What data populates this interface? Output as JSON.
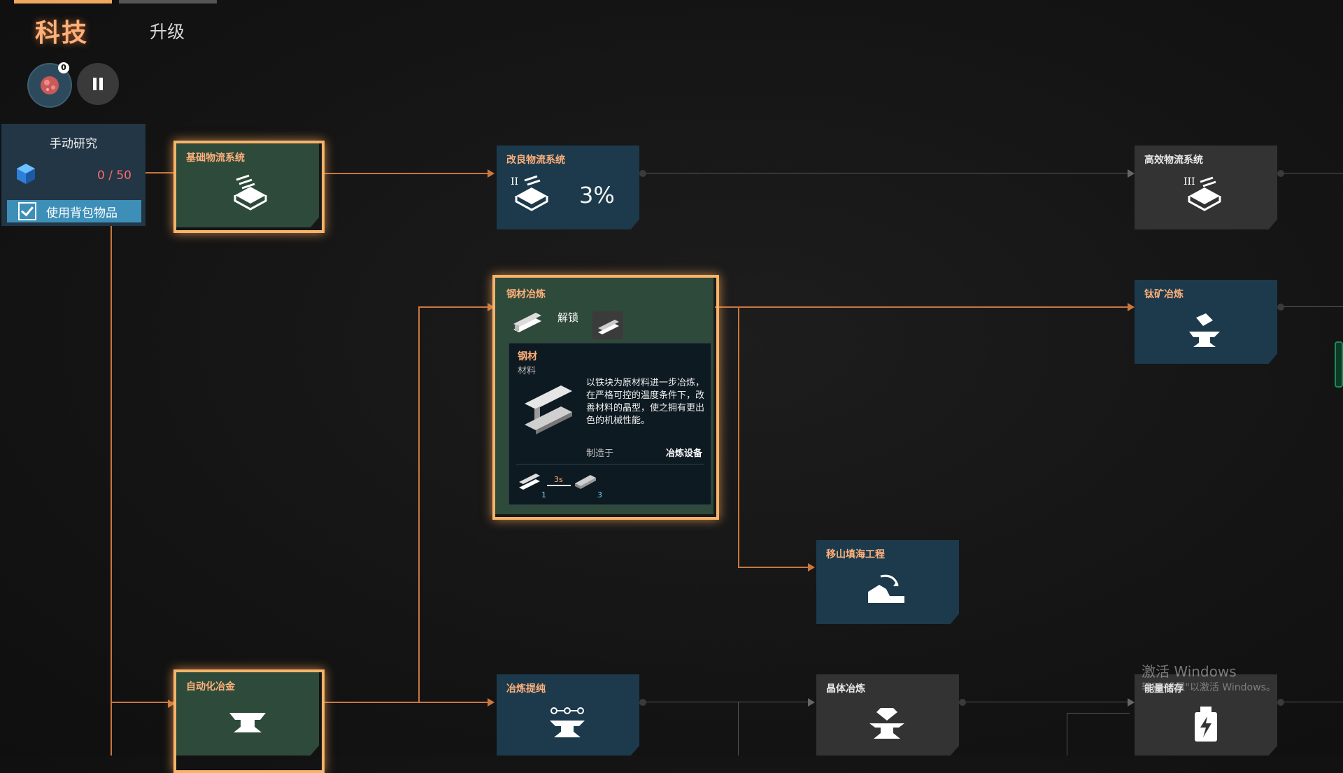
{
  "tabs": {
    "tech": "科技",
    "upgrade": "升级"
  },
  "resource_badge": "0",
  "manual_research": {
    "title": "手动研究",
    "count": "0 / 50",
    "use_items_label": "使用背包物品"
  },
  "nodes": {
    "basic_logistics": "基础物流系统",
    "improved_logistics": "改良物流系统",
    "improved_logistics_progress": "3%",
    "efficient_logistics": "高效物流系统",
    "steel_smelting": "钢材冶炼",
    "steel_unlock": "解锁",
    "titanium_smelting": "钛矿冶炼",
    "terraforming": "移山填海工程",
    "auto_metallurgy": "自动化冶金",
    "smelting_purification": "冶炼提纯",
    "crystal_smelting": "晶体冶炼",
    "energy_storage": "能量储存"
  },
  "tooltip": {
    "name": "钢材",
    "type": "材料",
    "description": "以铁块为原材料进一步冶炼，在严格可控的温度条件下，改善材料的晶型，使之拥有更出色的机械性能。",
    "made_in_label": "制造于",
    "made_in_value": "冶炼设备",
    "recipe_time": "3s",
    "output_qty": "1",
    "input_qty": "3"
  },
  "watermark": {
    "line1": "激活 Windows",
    "line2": "转到\"设置\"以激活 Windows。"
  },
  "colors": {
    "accent": "#f7b36a",
    "line": "#c9773f",
    "node_green": "#2e4a3a",
    "node_blue": "#1c3a4c",
    "node_grey": "#333333"
  }
}
